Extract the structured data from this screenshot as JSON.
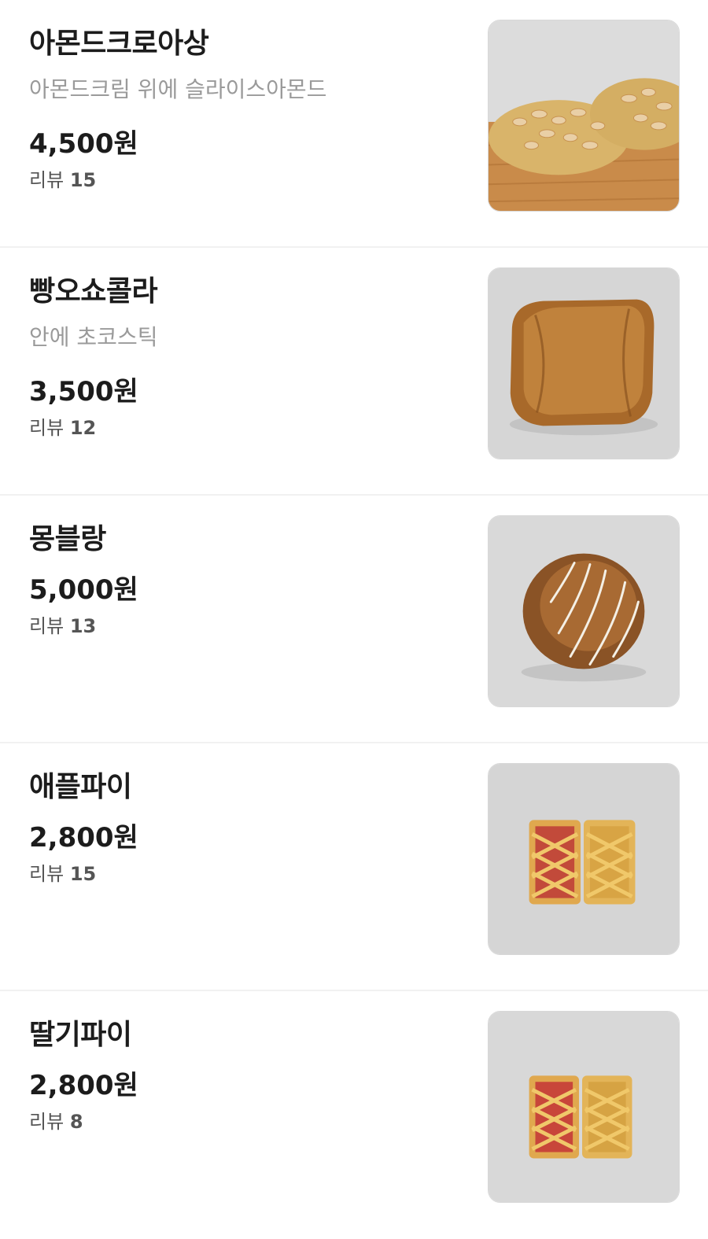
{
  "review_label": "리뷰",
  "items": [
    {
      "name": "아몬드크로아상",
      "description": "아몬드크림 위에 슬라이스아몬드",
      "price": "4,500원",
      "review_count": "15",
      "image": "almond-croissant-photo"
    },
    {
      "name": "빵오쇼콜라",
      "description": "안에 초코스틱",
      "price": "3,500원",
      "review_count": "12",
      "image": "pain-au-chocolat-photo"
    },
    {
      "name": "몽블랑",
      "description": "",
      "price": "5,000원",
      "review_count": "13",
      "image": "mont-blanc-photo"
    },
    {
      "name": "애플파이",
      "description": "",
      "price": "2,800원",
      "review_count": "15",
      "image": "apple-pie-photo"
    },
    {
      "name": "딸기파이",
      "description": "",
      "price": "2,800원",
      "review_count": "8",
      "image": "strawberry-pie-photo"
    }
  ]
}
